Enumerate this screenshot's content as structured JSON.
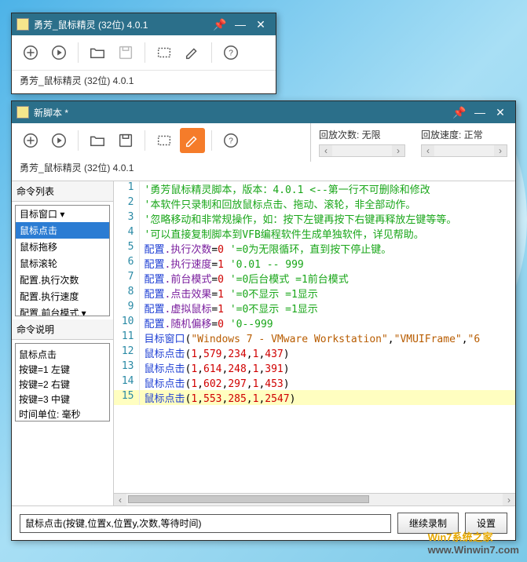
{
  "win1": {
    "title": "勇芳_鼠标精灵 (32位) 4.0.1",
    "subtitle": "勇芳_鼠标精灵 (32位) 4.0.1"
  },
  "win2": {
    "title": "新脚本 *",
    "subtitle": "勇芳_鼠标精灵 (32位) 4.0.1",
    "playback_count_label": "回放次数: 无限",
    "playback_speed_label": "回放速度: 正常"
  },
  "left_panel": {
    "cmd_list_title": "命令列表",
    "cmd_desc_title": "命令说明",
    "items": [
      "目标窗口",
      "鼠标点击",
      "鼠标拖移",
      "鼠标滚轮",
      "配置.执行次数",
      "配置.执行速度",
      "配置.前台模式"
    ],
    "selected_index": 1,
    "desc": [
      "鼠标点击",
      "按键=1 左键",
      "按键=2 右键",
      "按键=3 中键",
      "时间单位: 毫秒"
    ]
  },
  "editor": {
    "lines": [
      {
        "n": 1,
        "type": "cmt",
        "text": "'勇芳鼠标精灵脚本，版本：4.0.1  <--第一行不可删除和修改"
      },
      {
        "n": 2,
        "type": "cmt",
        "text": "'本软件只录制和回放鼠标点击、拖动、滚轮，非全部动作。"
      },
      {
        "n": 3,
        "type": "cmt",
        "text": "'忽略移动和非常规操作，如：按下左键再按下右键再释放左键等等。"
      },
      {
        "n": 4,
        "type": "cmt",
        "text": "'可以直接复制脚本到VFB编程软件生成单独软件，详见帮助。"
      },
      {
        "n": 5,
        "type": "cfg",
        "kw": "配置",
        "prop": ".执行次数",
        "eq": "=",
        "val": "0",
        "cmt": "'=0为无限循环，直到按下停止键。"
      },
      {
        "n": 6,
        "type": "cfg",
        "kw": "配置",
        "prop": ".执行速度",
        "eq": "=",
        "val": "1",
        "cmt": "'0.01 -- 999"
      },
      {
        "n": 7,
        "type": "cfg",
        "kw": "配置",
        "prop": ".前台模式",
        "eq": "=",
        "val": "0",
        "cmt": "'=0后台模式 =1前台模式"
      },
      {
        "n": 8,
        "type": "cfg",
        "kw": "配置",
        "prop": ".点击效果",
        "eq": "=",
        "val": "1",
        "cmt": "'=0不显示 =1显示"
      },
      {
        "n": 9,
        "type": "cfg",
        "kw": "配置",
        "prop": ".虚拟鼠标",
        "eq": "=",
        "val": "1",
        "cmt": "'=0不显示 =1显示"
      },
      {
        "n": 10,
        "type": "cfg",
        "kw": "配置",
        "prop": ".随机偏移",
        "eq": "=",
        "val": "0",
        "cmt": "'0--999"
      },
      {
        "n": 11,
        "type": "tgt",
        "kw": "目标窗口",
        "args": [
          "\"Windows 7 - VMware Workstation\"",
          "\"VMUIFrame\"",
          "\"6"
        ]
      },
      {
        "n": 12,
        "type": "clk",
        "kw": "鼠标点击",
        "nums": [
          "1",
          "579",
          "234",
          "1",
          "437"
        ]
      },
      {
        "n": 13,
        "type": "clk",
        "kw": "鼠标点击",
        "nums": [
          "1",
          "614",
          "248",
          "1",
          "391"
        ]
      },
      {
        "n": 14,
        "type": "clk",
        "kw": "鼠标点击",
        "nums": [
          "1",
          "602",
          "297",
          "1",
          "453"
        ]
      },
      {
        "n": 15,
        "type": "clk",
        "kw": "鼠标点击",
        "nums": [
          "1",
          "553",
          "285",
          "1",
          "2547"
        ],
        "hl": true
      }
    ]
  },
  "footer": {
    "input_value": "鼠标点击(按键,位置x,位置y,次数,等待时间)",
    "btn_continue": "继续录制",
    "btn_settings": "设置"
  },
  "watermark": {
    "brand": "Win7系统之家",
    "url": "www.Winwin7.com"
  }
}
